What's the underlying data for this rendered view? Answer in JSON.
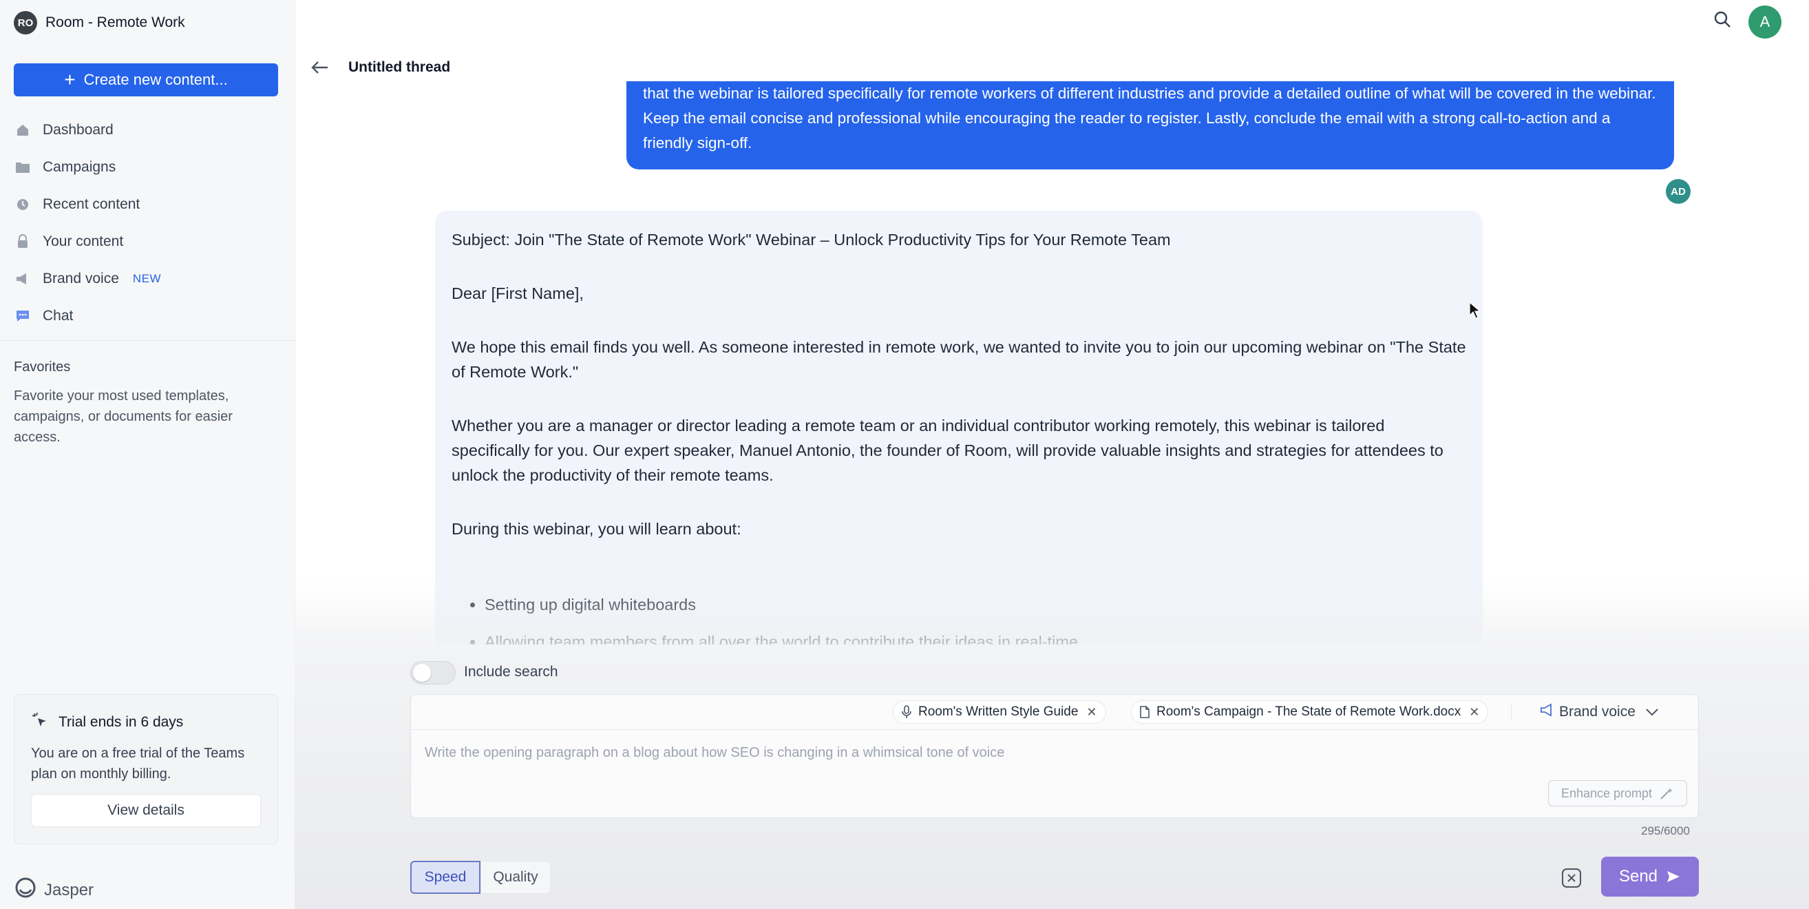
{
  "workspace": {
    "initials": "RO",
    "name": "Room - Remote Work"
  },
  "sidebar": {
    "create_label": "Create new content...",
    "items": [
      {
        "label": "Dashboard",
        "icon": "home-icon"
      },
      {
        "label": "Campaigns",
        "icon": "folder-icon"
      },
      {
        "label": "Recent content",
        "icon": "clock-icon"
      },
      {
        "label": "Your content",
        "icon": "lock-icon"
      },
      {
        "label": "Brand voice",
        "icon": "megaphone-icon",
        "badge": "NEW"
      },
      {
        "label": "Chat",
        "icon": "chat-icon"
      }
    ],
    "favorites_title": "Favorites",
    "favorites_desc": "Favorite your most used templates, campaigns, or documents for easier access.",
    "trial": {
      "title": "Trial ends in 6 days",
      "text": "You are on a free trial of the Teams plan on monthly billing.",
      "button": "View details"
    },
    "brand": "Jasper"
  },
  "header": {
    "user_initial": "A"
  },
  "thread": {
    "title": "Untitled thread",
    "user_message": "that the webinar is tailored specifically for remote workers of different industries and provide a detailed outline of what will be covered in the webinar. Keep the email concise and professional while encouraging the reader to register. Lastly, conclude the email with a strong call-to-action and a friendly sign-off.",
    "user_avatar": "AD",
    "ai_message": {
      "subject": "Subject: Join \"The State of Remote Work\" Webinar – Unlock Productivity Tips for Your Remote Team",
      "greeting": "Dear [First Name],",
      "p1": "We hope this email finds you well. As someone interested in remote work, we wanted to invite you to join our upcoming webinar on \"The State of Remote Work.\"",
      "p2": "Whether you are a manager or director leading a remote team or an individual contributor working remotely, this webinar is tailored specifically for you. Our expert speaker, Manuel Antonio, the founder of Room, will provide valuable insights and strategies for attendees to unlock the productivity of their remote teams.",
      "p3": "During this webinar, you will learn about:",
      "bullets": [
        "Setting up digital whiteboards",
        "Allowing team members from all over the world to contribute their ideas in real-time"
      ]
    }
  },
  "composer": {
    "include_search_label": "Include search",
    "chips": [
      {
        "label": "Room's Written Style Guide",
        "icon": "microphone-icon"
      },
      {
        "label": "Room's Campaign - The State of Remote Work.docx",
        "icon": "document-icon"
      }
    ],
    "brand_voice_label": "Brand voice",
    "placeholder": "Write the opening paragraph on a blog about how SEO is changing in a whimsical tone of voice",
    "enhance_label": "Enhance prompt",
    "counter": "295/6000",
    "mode_speed": "Speed",
    "mode_quality": "Quality",
    "send_label": "Send"
  }
}
